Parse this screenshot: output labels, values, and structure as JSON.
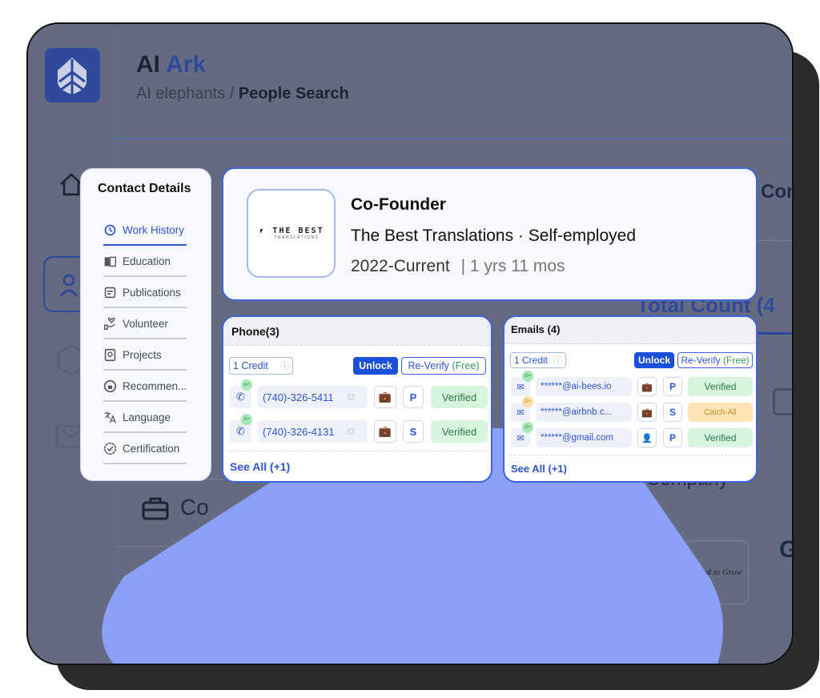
{
  "app": {
    "name_part1": "AI",
    "name_part2": "Ark",
    "breadcrumb_parent": "AI elephants /",
    "breadcrumb_current": "People Search"
  },
  "background": {
    "partial_heading": "Con",
    "total_count": "Total Count (4",
    "company": "Company",
    "company_initial": "G",
    "section_partial": "Co",
    "logo_text": "Good to Grow"
  },
  "contact_details": {
    "title": "Contact Details",
    "items": [
      {
        "label": "Work History",
        "icon": "history-icon",
        "active": true
      },
      {
        "label": "Education",
        "icon": "book-icon"
      },
      {
        "label": "Publications",
        "icon": "document-icon"
      },
      {
        "label": "Volunteer",
        "icon": "heart-hand-icon"
      },
      {
        "label": "Projects",
        "icon": "project-icon"
      },
      {
        "label": "Recommen...",
        "icon": "thumbs-up-icon"
      },
      {
        "label": "Language",
        "icon": "translate-icon"
      },
      {
        "label": "Certification",
        "icon": "badge-check-icon"
      }
    ]
  },
  "job": {
    "logo_text": "THE BEST",
    "logo_sub": "TRANSLATIONS",
    "title": "Co-Founder",
    "company": "The Best Translations · Self-employed",
    "period": "2022-Current",
    "duration": "| 1 yrs 11 mos"
  },
  "phone": {
    "title": "Phone(3)",
    "credit": "1 Credit",
    "unlock": "Unlock",
    "reverify": "Re-Verify",
    "free": "(Free)",
    "see_all": "See All (+1)",
    "rows": [
      {
        "grade": "A+",
        "value": "(740)-326-5411",
        "type_icon": "briefcase-icon",
        "tag": "P",
        "status": "Verified"
      },
      {
        "grade": "A+",
        "value": "(740)-326-4131",
        "type_icon": "briefcase-icon",
        "tag": "S",
        "status": "Verified"
      }
    ]
  },
  "emails": {
    "title": "Emails (4)",
    "credit": "1 Credit",
    "unlock": "Unlock",
    "reverify": "Re-Verify",
    "free": "(Free)",
    "see_all": "See All (+1)",
    "rows": [
      {
        "grade": "A+",
        "value": "******@ai-bees.io",
        "type_icon": "briefcase-icon",
        "tag": "P",
        "status": "Verified"
      },
      {
        "grade": "B+",
        "value": "******@airbnb.c...",
        "type_icon": "briefcase-icon",
        "tag": "S",
        "status": "Catch-All"
      },
      {
        "grade": "A+",
        "value": "******@gmail.com",
        "type_icon": "person-icon",
        "tag": "P",
        "status": "Verified"
      }
    ]
  },
  "colors": {
    "accent": "#2f55d4",
    "frame_overlay": "#646a80",
    "blob": "#8ca0f8",
    "verified": "#d6f5dc",
    "catch_all": "#fde4b4"
  }
}
